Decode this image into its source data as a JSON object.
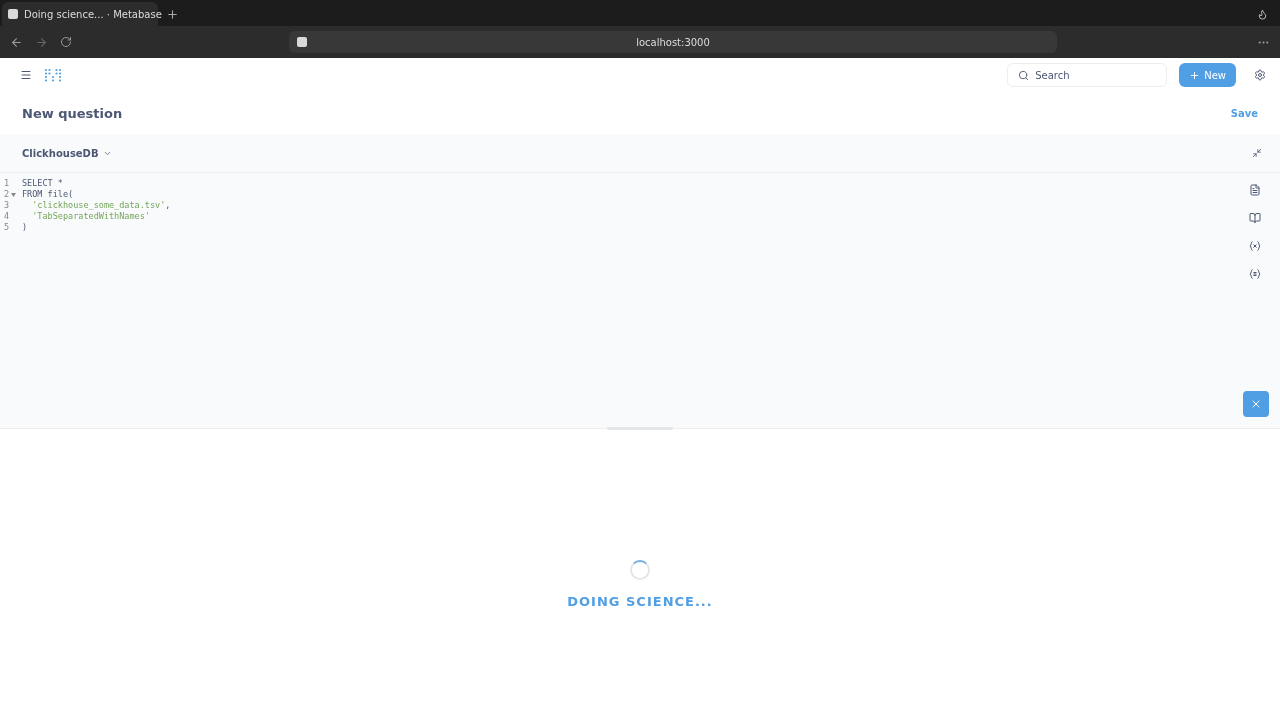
{
  "browser": {
    "tab_title": "Doing science... · Metabase",
    "address": "localhost:3000"
  },
  "header": {
    "search": {
      "placeholder": "Search"
    },
    "new_button": "New"
  },
  "question": {
    "title": "New question",
    "save": "Save"
  },
  "editor": {
    "database": "ClickhouseDB",
    "lines": [
      {
        "number": "1",
        "fold": false,
        "segments": [
          {
            "kind": "keyword",
            "text": "SELECT *"
          }
        ]
      },
      {
        "number": "2",
        "fold": true,
        "segments": [
          {
            "kind": "keyword",
            "text": "FROM file("
          }
        ]
      },
      {
        "number": "3",
        "fold": false,
        "indent": true,
        "segments": [
          {
            "kind": "string",
            "text": "'clickhouse_some_data.tsv'"
          },
          {
            "kind": "keyword",
            "text": ","
          }
        ]
      },
      {
        "number": "4",
        "fold": false,
        "indent": true,
        "segments": [
          {
            "kind": "string",
            "text": "'TabSeparatedWithNames'"
          }
        ]
      },
      {
        "number": "5",
        "fold": false,
        "segments": [
          {
            "kind": "keyword",
            "text": ")"
          }
        ]
      }
    ]
  },
  "results": {
    "loading": true,
    "message": "DOING SCIENCE..."
  }
}
